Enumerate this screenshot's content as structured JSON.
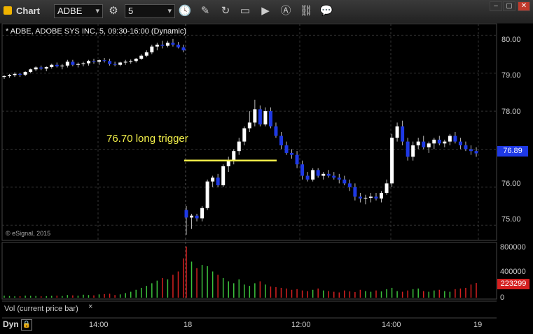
{
  "toolbar": {
    "app_title": "Chart",
    "symbol_value": "ADBE",
    "interval_value": "5",
    "icons": [
      "gear-icon",
      "clock-icon",
      "pencil-icon",
      "refresh-icon",
      "quote-icon",
      "play-icon",
      "alert-icon",
      "link-icon",
      "chat-icon"
    ]
  },
  "window_controls": [
    "minimize",
    "maximize",
    "close"
  ],
  "chart": {
    "header": "* ADBE, ADOBE SYS INC, 5, 09:30-16:00 (Dynamic)",
    "annotation": "76.70 long trigger",
    "watermark": "© eSignal, 2015",
    "price_badge": "76.89",
    "volume_badge": "223299",
    "volume_label": "Vol (current price bar)",
    "close_symbol": "×",
    "footer_label": "Dyn",
    "price_axis": [
      "80.00",
      "79.00",
      "78.00",
      "77.00",
      "76.00",
      "75.00"
    ],
    "volume_axis": [
      "800000",
      "400000",
      "0"
    ],
    "time_axis": [
      "14:00",
      "18",
      "12:00",
      "14:00",
      "19"
    ],
    "colors": {
      "up": "#ffffff",
      "down": "#1e39e6",
      "trigger": "#f3f04a",
      "vol_up": "#3cc23c",
      "vol_down": "#d42020"
    }
  },
  "chart_data": {
    "type": "candlestick",
    "price_range": [
      74.6,
      80.3
    ],
    "trigger_level": 76.7,
    "candles": [
      [
        78.9,
        78.95,
        78.85,
        78.92
      ],
      [
        78.92,
        78.98,
        78.88,
        78.95
      ],
      [
        78.95,
        79.02,
        78.9,
        78.98
      ],
      [
        78.98,
        79.0,
        78.9,
        78.96
      ],
      [
        78.96,
        79.05,
        78.92,
        79.03
      ],
      [
        79.03,
        79.12,
        79.0,
        79.1
      ],
      [
        79.1,
        79.18,
        79.05,
        79.15
      ],
      [
        79.15,
        79.2,
        79.08,
        79.12
      ],
      [
        79.12,
        79.18,
        79.05,
        79.16
      ],
      [
        79.16,
        79.25,
        79.12,
        79.22
      ],
      [
        79.22,
        79.28,
        79.15,
        79.18
      ],
      [
        79.18,
        79.24,
        79.1,
        79.2
      ],
      [
        79.2,
        79.35,
        79.15,
        79.3
      ],
      [
        79.3,
        79.35,
        79.18,
        79.22
      ],
      [
        79.22,
        79.28,
        79.15,
        79.24
      ],
      [
        79.24,
        79.3,
        79.18,
        79.26
      ],
      [
        79.26,
        79.35,
        79.2,
        79.32
      ],
      [
        79.32,
        79.38,
        79.25,
        79.3
      ],
      [
        79.3,
        79.36,
        79.22,
        79.34
      ],
      [
        79.34,
        79.4,
        79.28,
        79.32
      ],
      [
        79.32,
        79.38,
        79.2,
        79.24
      ],
      [
        79.24,
        79.3,
        79.18,
        79.22
      ],
      [
        79.22,
        79.3,
        79.18,
        79.28
      ],
      [
        79.28,
        79.35,
        79.22,
        79.3
      ],
      [
        79.3,
        79.36,
        79.25,
        79.32
      ],
      [
        79.32,
        79.4,
        79.28,
        79.38
      ],
      [
        79.38,
        79.5,
        79.35,
        79.46
      ],
      [
        79.46,
        79.6,
        79.42,
        79.55
      ],
      [
        79.55,
        79.75,
        79.5,
        79.7
      ],
      [
        79.7,
        79.8,
        79.6,
        79.75
      ],
      [
        79.75,
        79.85,
        79.65,
        79.72
      ],
      [
        79.72,
        79.85,
        79.68,
        79.8
      ],
      [
        79.8,
        79.9,
        79.7,
        79.75
      ],
      [
        79.75,
        79.82,
        79.65,
        79.68
      ],
      [
        79.68,
        79.75,
        79.55,
        79.6
      ],
      [
        75.4,
        75.5,
        74.75,
        75.2
      ],
      [
        75.2,
        75.3,
        74.9,
        75.25
      ],
      [
        75.25,
        75.3,
        75.1,
        75.18
      ],
      [
        75.18,
        75.5,
        75.1,
        75.45
      ],
      [
        75.45,
        76.2,
        75.4,
        76.15
      ],
      [
        76.15,
        76.3,
        76.0,
        76.25
      ],
      [
        76.25,
        76.35,
        76.0,
        76.05
      ],
      [
        76.05,
        76.6,
        76.0,
        76.55
      ],
      [
        76.55,
        76.8,
        76.4,
        76.7
      ],
      [
        76.7,
        77.0,
        76.6,
        76.95
      ],
      [
        76.95,
        77.3,
        76.85,
        77.2
      ],
      [
        77.2,
        77.6,
        77.1,
        77.55
      ],
      [
        77.55,
        78.0,
        77.45,
        77.7
      ],
      [
        77.7,
        78.3,
        77.6,
        78.05
      ],
      [
        78.05,
        78.15,
        77.6,
        77.65
      ],
      [
        77.65,
        78.1,
        77.6,
        78.0
      ],
      [
        78.0,
        78.1,
        77.55,
        77.6
      ],
      [
        77.6,
        77.7,
        77.3,
        77.35
      ],
      [
        77.35,
        77.45,
        77.0,
        77.1
      ],
      [
        77.1,
        77.2,
        76.85,
        76.9
      ],
      [
        76.9,
        77.0,
        76.75,
        76.85
      ],
      [
        76.85,
        76.95,
        76.5,
        76.6
      ],
      [
        76.6,
        76.7,
        76.2,
        76.3
      ],
      [
        76.3,
        76.4,
        76.15,
        76.2
      ],
      [
        76.2,
        76.5,
        76.15,
        76.45
      ],
      [
        76.45,
        76.5,
        76.25,
        76.3
      ],
      [
        76.3,
        76.4,
        76.2,
        76.35
      ],
      [
        76.35,
        76.45,
        76.25,
        76.3
      ],
      [
        76.3,
        76.4,
        76.2,
        76.25
      ],
      [
        76.25,
        76.35,
        76.1,
        76.2
      ],
      [
        76.2,
        76.3,
        76.05,
        76.1
      ],
      [
        76.1,
        76.2,
        75.9,
        76.0
      ],
      [
        76.0,
        76.1,
        75.65,
        75.75
      ],
      [
        75.75,
        75.85,
        75.6,
        75.7
      ],
      [
        75.7,
        75.8,
        75.55,
        75.72
      ],
      [
        75.72,
        75.85,
        75.6,
        75.75
      ],
      [
        75.75,
        75.85,
        75.65,
        75.7
      ],
      [
        75.7,
        75.9,
        75.6,
        75.85
      ],
      [
        75.85,
        76.2,
        75.8,
        76.1
      ],
      [
        76.1,
        77.4,
        76.0,
        77.3
      ],
      [
        77.3,
        77.7,
        77.2,
        77.6
      ],
      [
        77.6,
        77.75,
        77.1,
        77.2
      ],
      [
        77.2,
        77.3,
        76.7,
        76.8
      ],
      [
        76.8,
        77.2,
        76.7,
        77.1
      ],
      [
        77.1,
        77.3,
        77.0,
        77.2
      ],
      [
        77.2,
        77.35,
        77.0,
        77.05
      ],
      [
        77.05,
        77.2,
        76.9,
        77.15
      ],
      [
        77.15,
        77.3,
        77.0,
        77.25
      ],
      [
        77.25,
        77.35,
        77.1,
        77.15
      ],
      [
        77.15,
        77.25,
        77.05,
        77.2
      ],
      [
        77.2,
        77.4,
        77.1,
        77.35
      ],
      [
        77.35,
        77.45,
        77.15,
        77.2
      ],
      [
        77.2,
        77.3,
        77.0,
        77.1
      ],
      [
        77.1,
        77.2,
        76.95,
        77.0
      ],
      [
        77.0,
        77.1,
        76.85,
        76.95
      ],
      [
        76.95,
        77.05,
        76.8,
        76.89
      ]
    ],
    "volume_range": [
      0,
      800000
    ],
    "volume": [
      30000,
      25000,
      20000,
      22000,
      30000,
      28000,
      25000,
      20000,
      22000,
      28000,
      30000,
      25000,
      40000,
      35000,
      30000,
      45000,
      40000,
      35000,
      50000,
      55000,
      60000,
      40000,
      50000,
      70000,
      90000,
      120000,
      150000,
      180000,
      220000,
      260000,
      300000,
      280000,
      350000,
      400000,
      600000,
      780000,
      550000,
      450000,
      500000,
      480000,
      400000,
      350000,
      300000,
      250000,
      220000,
      280000,
      200000,
      180000,
      220000,
      250000,
      200000,
      170000,
      160000,
      150000,
      140000,
      120000,
      130000,
      110000,
      100000,
      120000,
      140000,
      110000,
      100000,
      90000,
      80000,
      110000,
      95000,
      85000,
      120000,
      100000,
      90000,
      110000,
      95000,
      130000,
      150000,
      100000,
      90000,
      110000,
      130000,
      140000,
      100000,
      90000,
      110000,
      120000,
      100000,
      90000,
      130000,
      140000,
      150000,
      200000,
      223299
    ]
  }
}
